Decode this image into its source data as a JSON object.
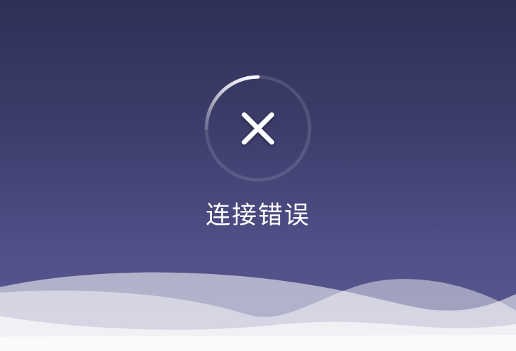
{
  "status": {
    "icon": "close-icon",
    "message": "连接错误",
    "ring_progress": 0.25
  },
  "colors": {
    "background_top": "#2f3057",
    "background_bottom": "#5a5a92",
    "ring_track": "#ffffff",
    "text": "#ffffff",
    "wave": "#f3f3f7"
  }
}
